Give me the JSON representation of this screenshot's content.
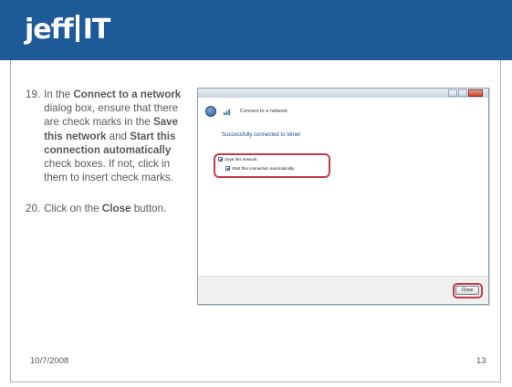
{
  "header": {
    "logo_left": "jeff",
    "logo_right": "IT",
    "bg_color": "#1f5a98"
  },
  "steps": [
    {
      "number": "19.",
      "segments": [
        {
          "text": "In the ",
          "bold": false
        },
        {
          "text": "Connect to a network",
          "bold": true
        },
        {
          "text": " dialog box, ensure that there are check marks in the ",
          "bold": false
        },
        {
          "text": "Save this network",
          "bold": true
        },
        {
          "text": " and ",
          "bold": false
        },
        {
          "text": "Start this connection automatically",
          "bold": true
        },
        {
          "text": " check boxes. If not, click in them to insert check marks.",
          "bold": false
        }
      ]
    },
    {
      "number": "20.",
      "segments": [
        {
          "text": "Click on the ",
          "bold": false
        },
        {
          "text": "Close",
          "bold": true
        },
        {
          "text": " button.",
          "bold": false
        }
      ]
    }
  ],
  "screenshot": {
    "nav_title": "Connect to a network",
    "success_message": "Successfully connected to Ietnet",
    "checkbox_save": "Save this network",
    "checkbox_start": "Start this connection automatically",
    "close_button": "Close",
    "highlight_color": "#c43a4a"
  },
  "footer": {
    "date": "10/7/2008",
    "page_number": "13"
  }
}
